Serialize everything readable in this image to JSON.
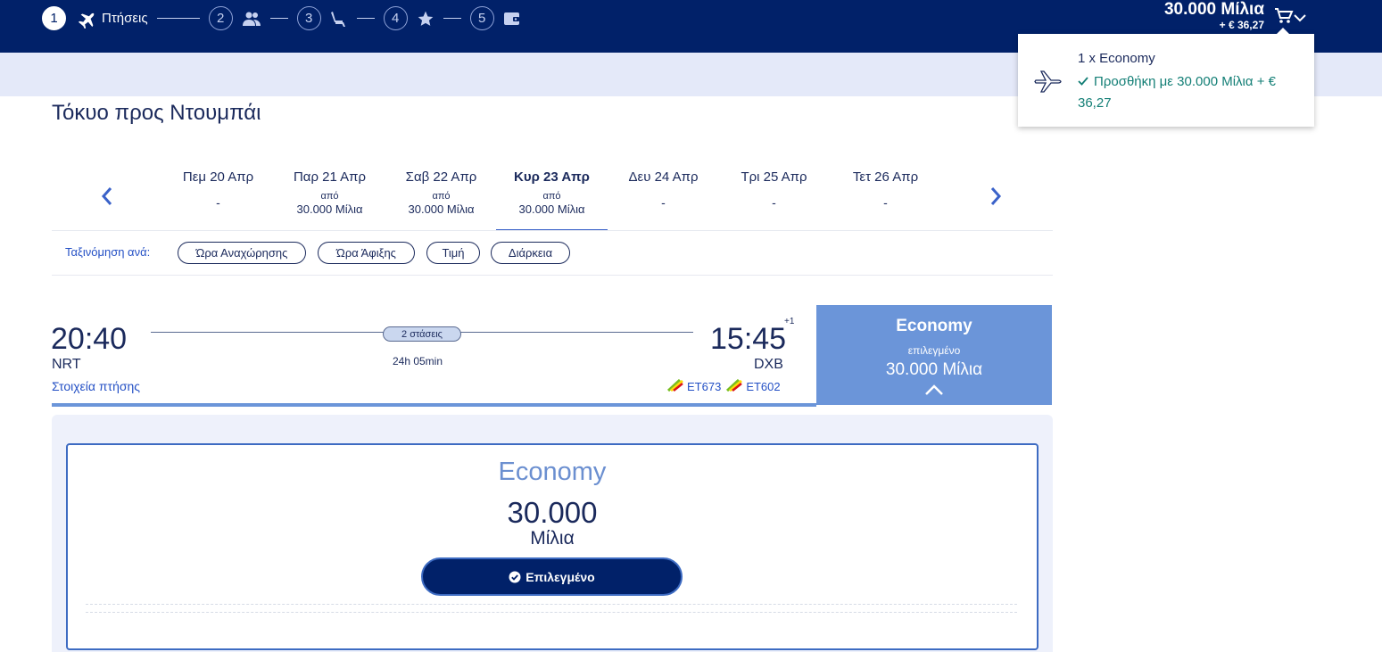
{
  "stepper": {
    "steps": [
      {
        "number": "1",
        "label": "Πτήσεις",
        "icon": "plane-icon"
      },
      {
        "number": "2",
        "icon": "passengers-icon"
      },
      {
        "number": "3",
        "icon": "seat-icon"
      },
      {
        "number": "4",
        "icon": "star-icon"
      },
      {
        "number": "5",
        "icon": "wallet-icon"
      }
    ]
  },
  "cart": {
    "miles": "30.000 Μίλια",
    "euro": "+ € 36,27",
    "popup": {
      "item": "1 x Economy",
      "added": "Προσθήκη με 30.000 Μίλια + € 36,27"
    }
  },
  "page": {
    "title": "Τόκυο προς Ντουμπάι"
  },
  "dates": [
    {
      "label": "Πεμ 20 Απρ",
      "dash": "-"
    },
    {
      "label": "Παρ 21 Απρ",
      "apo": "από",
      "miles": "30.000 Μίλια"
    },
    {
      "label": "Σαβ 22 Απρ",
      "apo": "από",
      "miles": "30.000 Μίλια"
    },
    {
      "label": "Κυρ 23 Απρ",
      "apo": "από",
      "miles": "30.000 Μίλια"
    },
    {
      "label": "Δευ 24 Απρ",
      "dash": "-"
    },
    {
      "label": "Τρι 25 Απρ",
      "dash": "-"
    },
    {
      "label": "Τετ 26 Απρ",
      "dash": "-"
    }
  ],
  "sort": {
    "label": "Ταξινόμηση ανά:",
    "options": [
      "Ώρα Αναχώρησης",
      "Ώρα Άφιξης",
      "Τιμή",
      "Διάρκεια"
    ]
  },
  "flight": {
    "departure_time": "20:40",
    "departure_code": "NRT",
    "arrival_time": "15:45",
    "arrival_offset": "+1",
    "arrival_code": "DXB",
    "details_link": "Στοιχεία πτήσης",
    "stops": "2 στάσεις",
    "duration": "24h 05min",
    "flight_numbers": [
      "ET673",
      "ET602"
    ]
  },
  "economy_card": {
    "title": "Economy",
    "status": "επιλεγμένο",
    "price": "30.000 Μίλια"
  },
  "fare": {
    "title": "Economy",
    "value": "30.000",
    "unit": "Μίλια",
    "button": "Επιλεγμένο"
  },
  "colors": {
    "brand_navy": "#012169",
    "accent_blue": "#6b95d9",
    "success_green": "#127e75"
  }
}
